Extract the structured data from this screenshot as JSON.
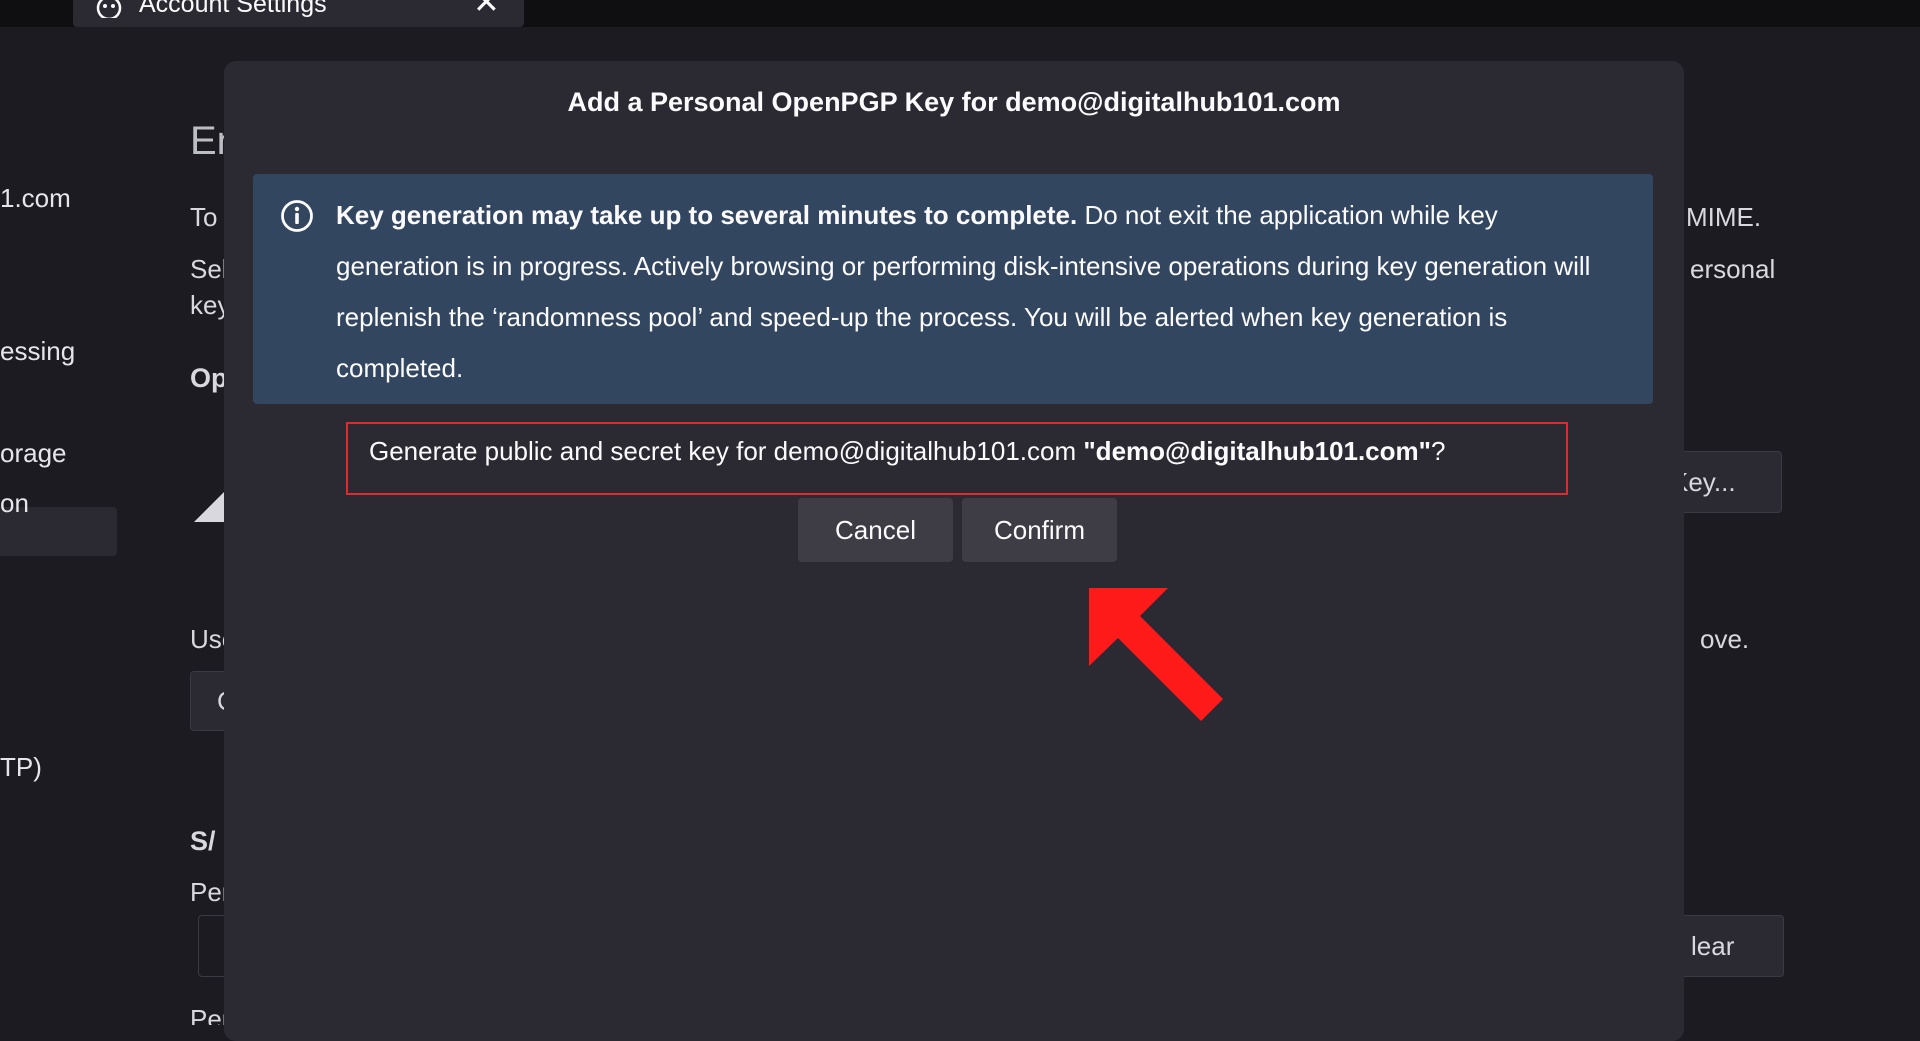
{
  "window": {
    "tab_title": "Account Settings",
    "tab_close": "✕"
  },
  "sidebar": {
    "items": [
      {
        "label": "1.com"
      },
      {
        "label": "essing"
      },
      {
        "label": "orage"
      },
      {
        "label": "on"
      },
      {
        "label": "TP)"
      }
    ]
  },
  "background": {
    "heading": "En",
    "line1": "To",
    "line1_right": "MIME.",
    "line2": "Sel",
    "line2_right": "ersonal",
    "line3": "key",
    "section_openpgp": "Op",
    "add_key_button": "Key...",
    "use_text": "Use",
    "use_text_right": "ove.",
    "small_button": "C",
    "section_smime": "S/",
    "personal_label1": "Per",
    "clear_button": "lear",
    "personal_label2": "Per"
  },
  "dialog": {
    "title": "Add a Personal OpenPGP Key for demo@digitalhub101.com",
    "notice": {
      "icon": "info-icon",
      "bold": "Key generation may take up to several minutes to complete.",
      "text": " Do not exit the application while key generation is in progress. Actively browsing or performing disk-intensive operations during key generation will replenish the ‘randomness pool’ and speed-up the process. You will be alerted when key generation is completed."
    },
    "question": {
      "prefix": "Generate public and secret key for demo@digitalhub101.com ",
      "bold": "\"demo@digitalhub101.com\"",
      "suffix": "?"
    },
    "cancel_label": "Cancel",
    "confirm_label": "Confirm"
  },
  "annotation": {
    "color": "#ff1a1a",
    "highlight_color": "#e22a2a"
  }
}
